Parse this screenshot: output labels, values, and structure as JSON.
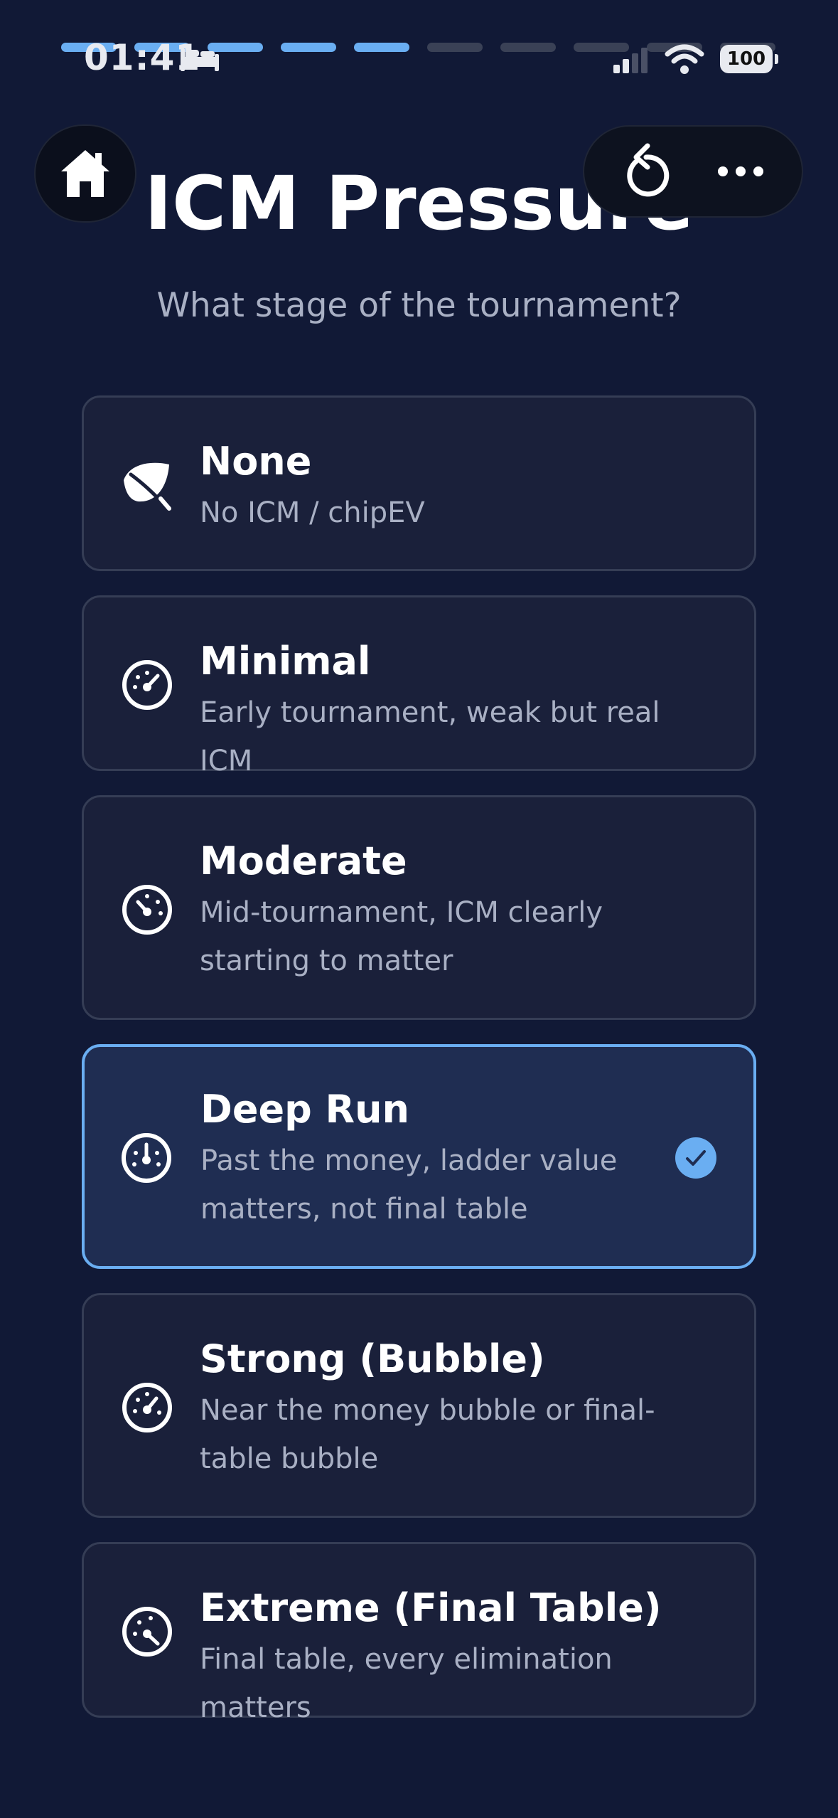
{
  "status_bar": {
    "time": "01:41",
    "battery": "100"
  },
  "progress": {
    "total_steps": 10,
    "completed_steps": 5
  },
  "header": {
    "title": "ICM Pressure",
    "subtitle": "What stage of the tournament?"
  },
  "icons": {
    "home": "home-icon",
    "restart": "restart-icon",
    "more": "more-icon"
  },
  "options": [
    {
      "icon": "leaf-icon",
      "title": "None",
      "description": "No ICM / chipEV",
      "selected": false
    },
    {
      "icon": "gauge-low-icon",
      "title": "Minimal",
      "description": "Early tournament, weak but real ICM",
      "selected": false
    },
    {
      "icon": "gauge-mid-icon",
      "title": "Moderate",
      "description": "Mid-tournament, ICM clearly starting to matter",
      "selected": false
    },
    {
      "icon": "gauge-high-icon",
      "title": "Deep Run",
      "description": "Past the money, ladder value matters, not final table",
      "selected": true
    },
    {
      "icon": "gauge-strong-icon",
      "title": "Strong (Bubble)",
      "description": "Near the money bubble or final-table bubble",
      "selected": false
    },
    {
      "icon": "gauge-max-icon",
      "title": "Extreme (Final Table)",
      "description": "Final table, every elimination matters",
      "selected": false
    }
  ],
  "colors": {
    "background": "#111936",
    "card": "#1a203a",
    "card_selected": "#1f2d52",
    "accent": "#6aaef2",
    "muted_text": "#a9b0c4"
  }
}
